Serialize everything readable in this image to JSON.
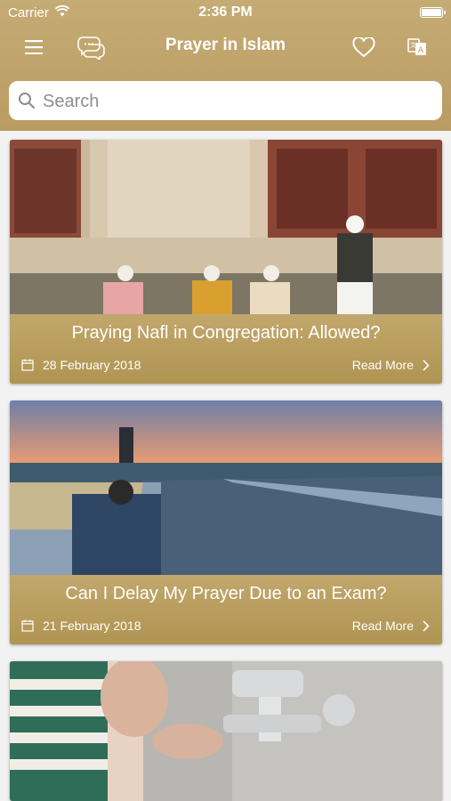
{
  "status_bar": {
    "carrier": "Carrier",
    "time": "2:36 PM"
  },
  "nav": {
    "title": "Prayer in Islam"
  },
  "search": {
    "placeholder": "Search"
  },
  "articles": [
    {
      "title": "Praying Nafl in Congregation: Allowed?",
      "date": "28 February 2018",
      "read_more": "Read More"
    },
    {
      "title": "Can I Delay My Prayer Due to an Exam?",
      "date": "21 February 2018",
      "read_more": "Read More"
    }
  ],
  "colors": {
    "header": "#bfa36a",
    "card_caption": "#b59a5c",
    "background": "#f2f2f2"
  }
}
